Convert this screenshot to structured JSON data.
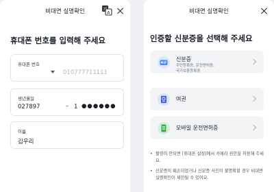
{
  "left_panel": {
    "header_title": "비대면 실명확인",
    "heading": "휴대폰 번호를 입력해 주세요",
    "phone": {
      "label": "휴대폰 번호",
      "placeholder": "010777711111"
    },
    "birth": {
      "label": "생년월일",
      "value": "027897",
      "dash": "–",
      "rrn_first_digit": "1",
      "rrn_mask": "●●●●●●"
    },
    "name": {
      "label": "이름",
      "value": "김우리"
    }
  },
  "right_panel": {
    "header_title": "비대면 실명확인",
    "heading": "인증할 신분증을 선택해 주세요",
    "options": [
      {
        "title": "신분증",
        "sub_line1": "주민등록증, 운전면허증,",
        "sub_line2": "국가보훈등록증",
        "icon": "id-card-icon"
      },
      {
        "title": "여권",
        "icon": "passport-icon"
      },
      {
        "title": "모바일 운전면허증",
        "icon": "mobile-license-icon"
      }
    ],
    "notes": [
      "촬영이 안되면 [휴대폰 설정]에서 카메라 권한을 허용해 주세요.",
      "신분증이 훼손되었거나 신분증 사진이 불명확할 경우 비대면 실명확인이 제한될 수 있어요."
    ]
  },
  "colors": {
    "background": "#eef0f3",
    "card_bg": "#f2f4f6",
    "id_icon_blue": "#4c8ef7",
    "passport_icon_blue": "#3b5bdb",
    "license_icon_green": "#37b24d"
  }
}
